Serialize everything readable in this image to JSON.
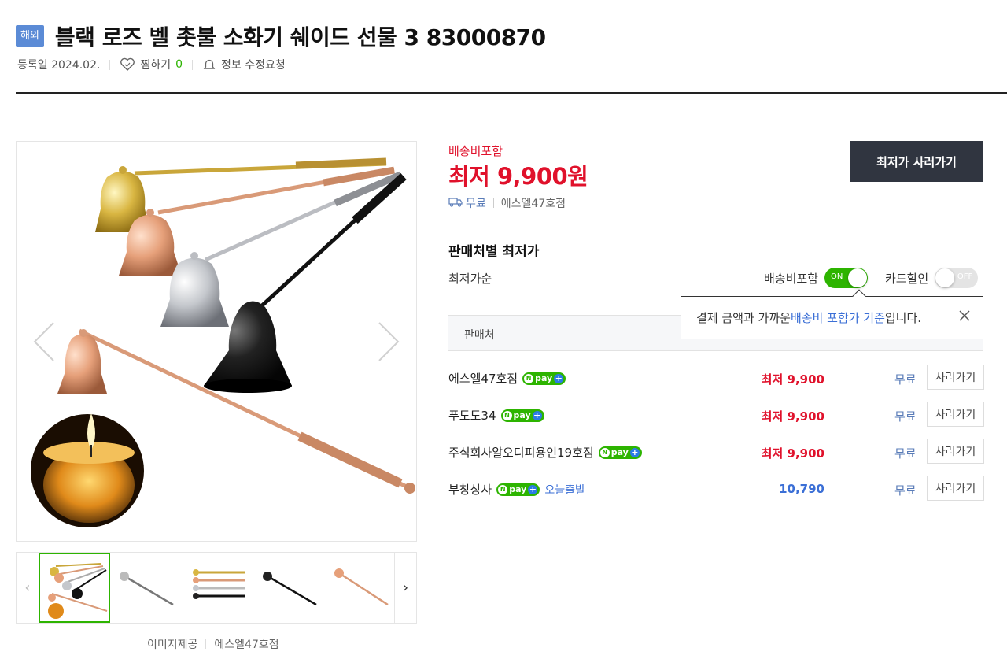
{
  "header": {
    "badge": "해외",
    "title": "블랙 로즈 벨 촛불 소화기 쉐이드 선물 3 83000870"
  },
  "meta": {
    "registered": "등록일 2024.02.",
    "wishlist_label": "찜하기",
    "wishlist_count": "0",
    "report_label": "정보 수정요청"
  },
  "gallery": {
    "credit_label": "이미지제공",
    "credit_store": "에스엘47호점"
  },
  "summary": {
    "shipping_included": "배송비포함",
    "lowest_price": "최저 9,900원",
    "shipping_free": "무료",
    "store": "에스엘47호점",
    "buy_button": "최저가 사러가기"
  },
  "sellers_section": {
    "title": "판매처별 최저가",
    "sort_label": "최저가순",
    "toggle_shipping": {
      "label": "배송비포함",
      "state": "ON"
    },
    "toggle_card": {
      "label": "카드할인",
      "state": "OFF"
    },
    "tooltip": {
      "prefix": "결제 금액과 가까운 ",
      "accent": "배송비 포함가 기준",
      "suffix": "입니다."
    },
    "header_seller": "판매처",
    "npay": "pay",
    "rows": [
      {
        "name": "에스엘47호점",
        "price": "최저 9,900",
        "shipping": "무료",
        "buy": "사러가기",
        "tag": ""
      },
      {
        "name": "푸도도34",
        "price": "최저 9,900",
        "shipping": "무료",
        "buy": "사러가기",
        "tag": ""
      },
      {
        "name": "주식회사알오디피용인19호점",
        "price": "최저 9,900",
        "shipping": "무료",
        "buy": "사러가기",
        "tag": ""
      },
      {
        "name": "부창상사",
        "price": "10,790",
        "shipping": "무료",
        "buy": "사러가기",
        "tag": "오늘출발"
      }
    ]
  },
  "colors": {
    "accent_red": "#e0112b",
    "accent_green": "#2db400",
    "accent_blue": "#3b6fd6",
    "button_dark": "#303540"
  }
}
